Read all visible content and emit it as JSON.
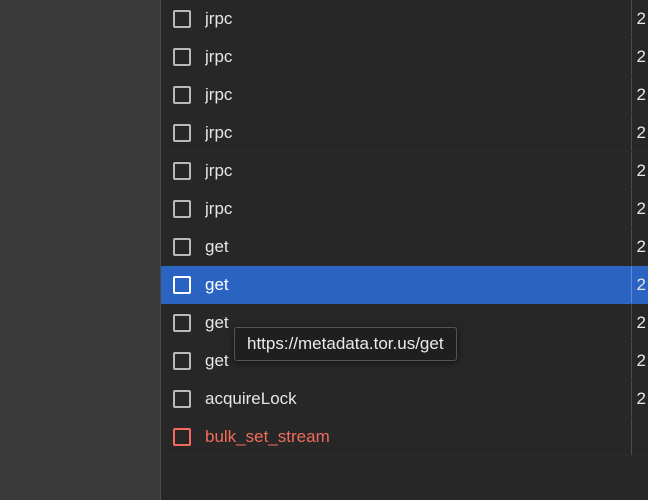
{
  "tooltip": "https://metadata.tor.us/get",
  "trailing_glyph": "2",
  "rows": [
    {
      "name": "jrpc",
      "selected": false,
      "error": false
    },
    {
      "name": "jrpc",
      "selected": false,
      "error": false
    },
    {
      "name": "jrpc",
      "selected": false,
      "error": false
    },
    {
      "name": "jrpc",
      "selected": false,
      "error": false
    },
    {
      "name": "jrpc",
      "selected": false,
      "error": false
    },
    {
      "name": "jrpc",
      "selected": false,
      "error": false
    },
    {
      "name": "get",
      "selected": false,
      "error": false
    },
    {
      "name": "get",
      "selected": true,
      "error": false
    },
    {
      "name": "get",
      "selected": false,
      "error": false
    },
    {
      "name": "get",
      "selected": false,
      "error": false
    },
    {
      "name": "acquireLock",
      "selected": false,
      "error": false
    },
    {
      "name": "bulk_set_stream",
      "selected": false,
      "error": true
    }
  ]
}
